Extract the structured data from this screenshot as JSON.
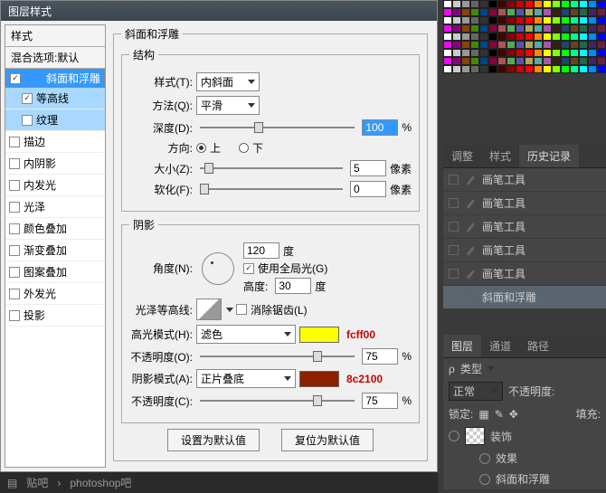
{
  "dialog": {
    "title": "图层样式",
    "styles_header": "样式",
    "blend_header": "混合选项:默认",
    "items": [
      {
        "label": "斜面和浮雕",
        "checked": true,
        "sel": true
      },
      {
        "label": "等高线",
        "checked": true,
        "hl": true,
        "indent": true
      },
      {
        "label": "纹理",
        "checked": false,
        "hl": true,
        "indent": true
      },
      {
        "label": "描边",
        "checked": false
      },
      {
        "label": "内阴影",
        "checked": false
      },
      {
        "label": "内发光",
        "checked": false
      },
      {
        "label": "光泽",
        "checked": false
      },
      {
        "label": "颜色叠加",
        "checked": false
      },
      {
        "label": "渐变叠加",
        "checked": false
      },
      {
        "label": "图案叠加",
        "checked": false
      },
      {
        "label": "外发光",
        "checked": false
      },
      {
        "label": "投影",
        "checked": false
      }
    ]
  },
  "bevel": {
    "group": "斜面和浮雕",
    "struct": "结构",
    "style_lbl": "样式(T):",
    "style_val": "内斜面",
    "tech_lbl": "方法(Q):",
    "tech_val": "平滑",
    "depth_lbl": "深度(D):",
    "depth_val": "100",
    "pct": "%",
    "dir_lbl": "方向:",
    "up": "上",
    "down": "下",
    "size_lbl": "大小(Z):",
    "size_val": "5",
    "px": "像素",
    "soft_lbl": "软化(F):",
    "soft_val": "0"
  },
  "shade": {
    "group": "阴影",
    "angle_lbl": "角度(N):",
    "angle_val": "120",
    "deg": "度",
    "global": "使用全局光(G)",
    "alt_lbl": "高度:",
    "alt_val": "30",
    "gloss_lbl": "光泽等高线:",
    "anti": "消除锯齿(L)",
    "hi_lbl": "高光模式(H):",
    "hi_val": "滤色",
    "hi_color": "#fcff00",
    "hi_anno": "fcff00",
    "hi_op_lbl": "不透明度(O):",
    "hi_op": "75",
    "sh_lbl": "阴影模式(A):",
    "sh_val": "正片叠底",
    "sh_color": "#8c2100",
    "sh_anno": "8c2100",
    "sh_op_lbl": "不透明度(C):",
    "sh_op": "75"
  },
  "buttons": {
    "def": "设置为默认值",
    "reset": "复位为默认值"
  },
  "panels": {
    "hist_tabs": [
      "调整",
      "样式",
      "历史记录"
    ],
    "hist_items": [
      "画笔工具",
      "画笔工具",
      "画笔工具",
      "画笔工具",
      "画笔工具",
      "斜面和浮雕"
    ],
    "layer_tabs": [
      "图层",
      "通道",
      "路径"
    ],
    "kind": "类型",
    "normal": "正常",
    "opacity": "不透明度:",
    "lock": "锁定:",
    "fill": "填充:",
    "layer_name": "装饰",
    "fx": "效果",
    "fx_item": "斜面和浮雕"
  },
  "footer": {
    "a": "贴吧",
    "b": "photoshop吧"
  },
  "palette_colors": [
    "#fff",
    "#ccc",
    "#999",
    "#666",
    "#333",
    "#000",
    "#400",
    "#800",
    "#c00",
    "#f00",
    "#f80",
    "#ff0",
    "#8f0",
    "#0f0",
    "#0f8",
    "#0ff",
    "#08f",
    "#00f",
    "#f0f",
    "#808",
    "#840",
    "#480",
    "#048",
    "#804",
    "#a55",
    "#5a5",
    "#55a",
    "#aa5",
    "#5aa",
    "#a5a",
    "#321",
    "#246",
    "#642",
    "#264",
    "#426",
    "#624"
  ]
}
